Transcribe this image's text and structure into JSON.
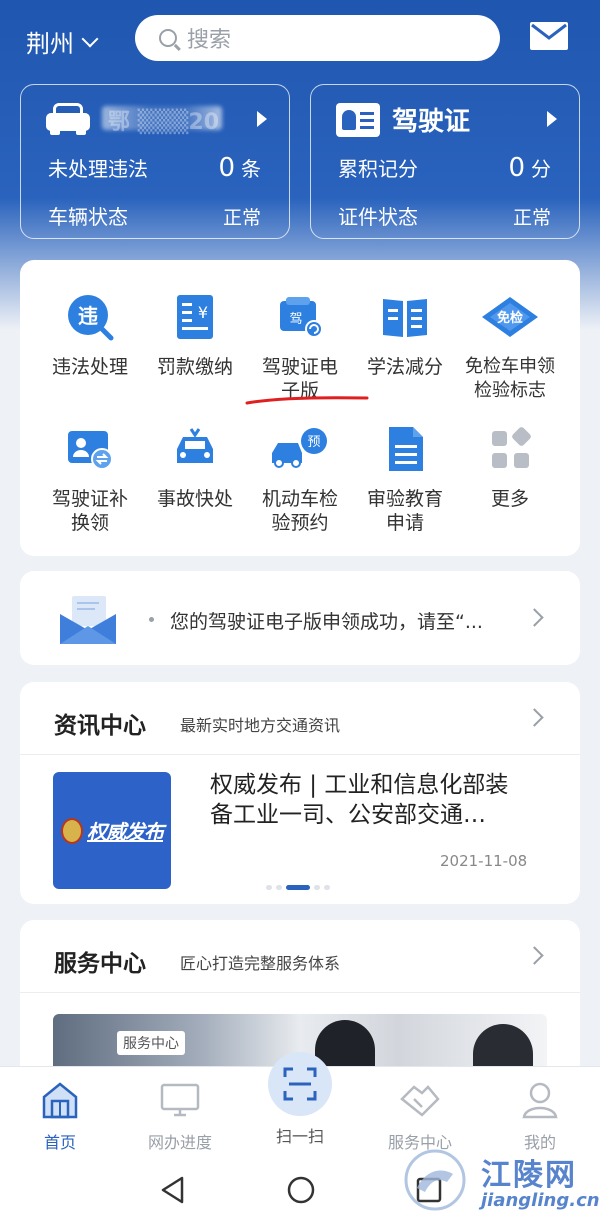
{
  "header": {
    "city": "荆州",
    "search_placeholder": "搜索"
  },
  "vehicle_card": {
    "plate": "鄂 ▒▒▒20",
    "violations_label": "未处理违法",
    "violations_value": "0",
    "violations_unit": "条",
    "status_label": "车辆状态",
    "status_value": "正常"
  },
  "license_card": {
    "title": "驾驶证",
    "points_label": "累积记分",
    "points_value": "0",
    "points_unit": "分",
    "status_label": "证件状态",
    "status_value": "正常"
  },
  "services": [
    {
      "line1": "违法处理",
      "line2": "",
      "icon": "violation-icon"
    },
    {
      "line1": "罚款缴纳",
      "line2": "",
      "icon": "fine-icon"
    },
    {
      "line1": "驾驶证电",
      "line2": "子版",
      "icon": "e-license-icon"
    },
    {
      "line1": "学法减分",
      "line2": "",
      "icon": "book-icon"
    },
    {
      "line1": "免检车申领",
      "line2": "检验标志",
      "icon": "exempt-icon"
    },
    {
      "line1": "驾驶证补",
      "line2": "换领",
      "icon": "license-renew-icon"
    },
    {
      "line1": "事故快处",
      "line2": "",
      "icon": "accident-icon"
    },
    {
      "line1": "机动车检",
      "line2": "验预约",
      "icon": "inspection-icon"
    },
    {
      "line1": "审验教育",
      "line2": "申请",
      "icon": "document-icon"
    },
    {
      "line1": "更多",
      "line2": "",
      "icon": "more-grid-icon"
    }
  ],
  "service_icon_badges": {
    "violation": "违",
    "fine": "¥",
    "license": "驾",
    "exempt": "免检",
    "inspection": "预"
  },
  "notice": {
    "text": "您的驾驶证电子版申领成功，请至“..."
  },
  "news": {
    "title": "资讯中心",
    "subtitle": "最新实时地方交通资讯",
    "thumb_text": "权威发布",
    "headline_line1": "权威发布 | 工业和信息化部装",
    "headline_line2": "备工业一司、公安部交通…",
    "date": "2021-11-08"
  },
  "service_center": {
    "title": "服务中心",
    "subtitle": "匠心打造完整服务体系",
    "banner_tag": "服务中心"
  },
  "tabs": [
    {
      "label": "首页",
      "active": true
    },
    {
      "label": "网办进度",
      "active": false
    },
    {
      "label": "扫一扫",
      "active": false
    },
    {
      "label": "服务中心",
      "active": false
    },
    {
      "label": "我的",
      "active": false
    }
  ],
  "watermark": {
    "name": "江陵网",
    "domain": "jiangling.cn"
  },
  "colors": {
    "brand_blue": "#2a63bd",
    "annotation_red": "#e02020"
  }
}
